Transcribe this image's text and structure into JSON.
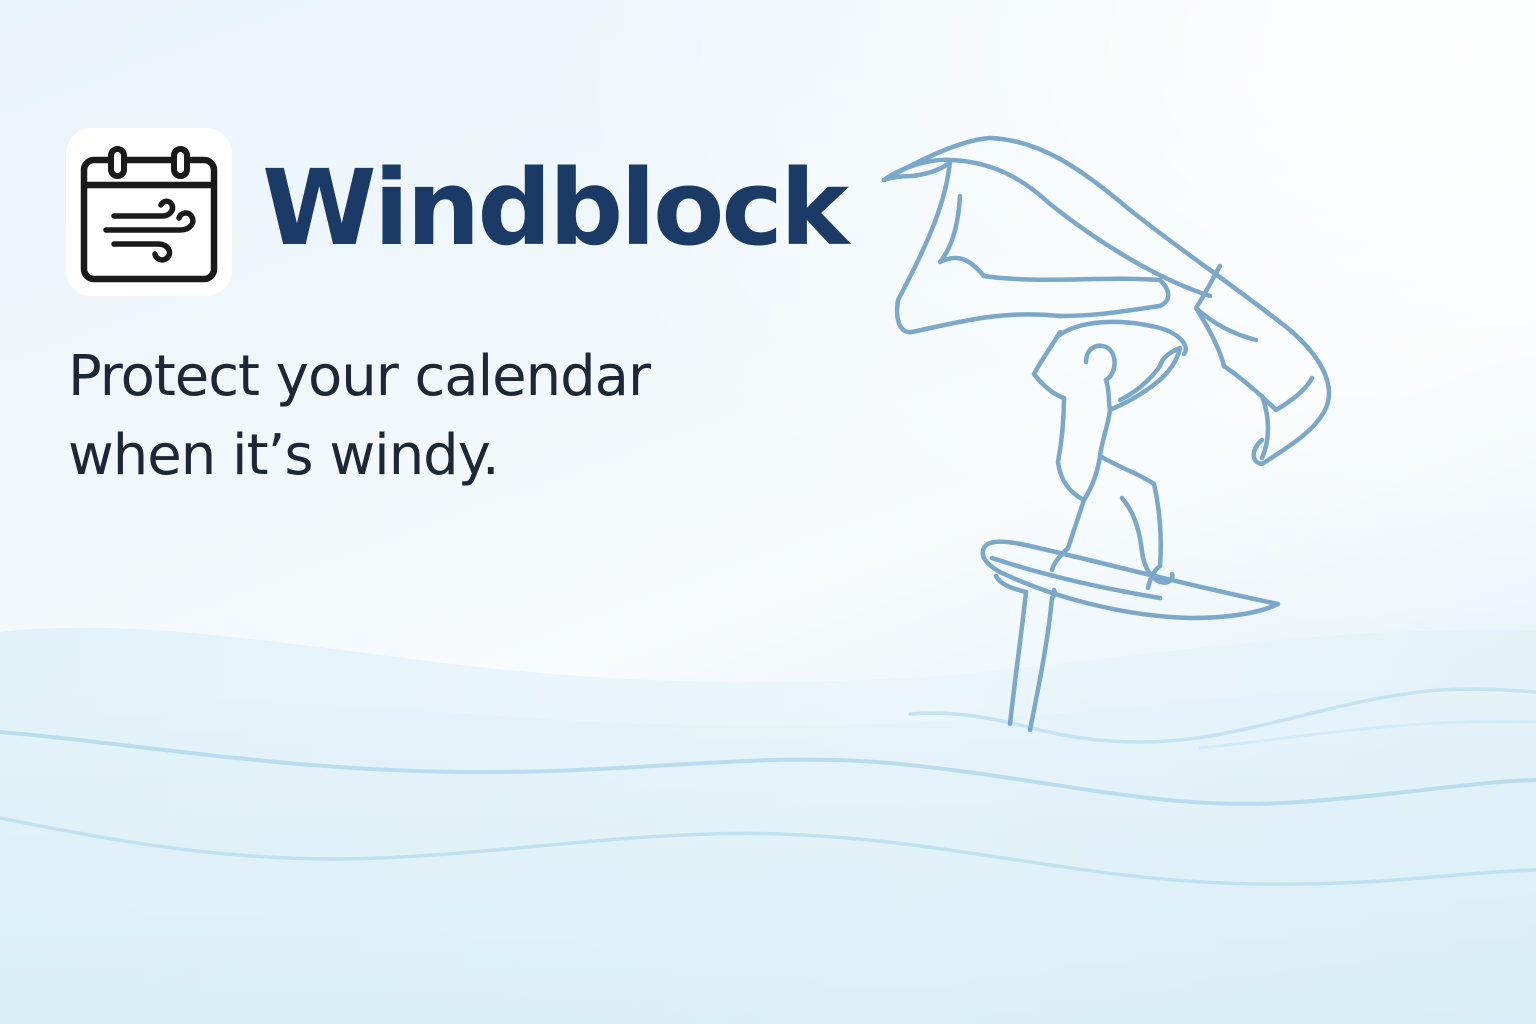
{
  "brand": {
    "name": "Windblock",
    "icon": "calendar-wind-icon"
  },
  "tagline": {
    "line1": "Protect your calendar",
    "line2": "when it’s windy."
  },
  "illustration": {
    "subject": "wing-foiler-illustration",
    "line_color": "#7ba7c9"
  },
  "colors": {
    "brand_text": "#1c3a66",
    "tagline_text": "#1d2735",
    "wave_light": "#bfdeee"
  }
}
